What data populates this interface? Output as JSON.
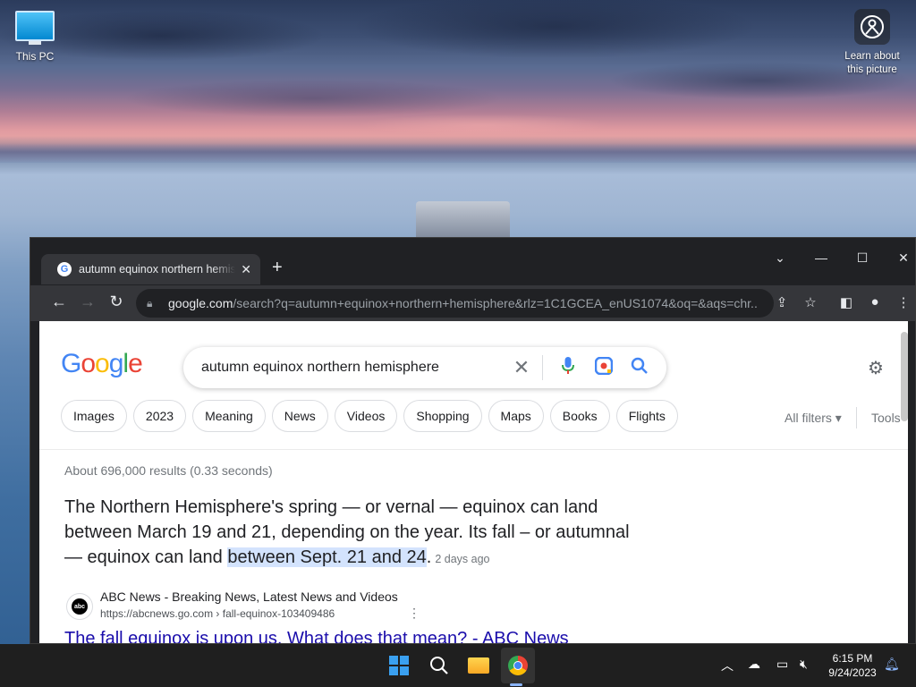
{
  "desktop": {
    "icons": [
      {
        "label": "This PC"
      },
      {
        "label": "Learn about this picture"
      }
    ]
  },
  "browser": {
    "tab_title": "autumn equinox northern hemisphere - Google Search",
    "url_host": "google.com",
    "url_rest": "/search?q=autumn+equinox+northern+hemisphere&rlz=1C1GCEA_enUS1074&oq=&aqs=chr..."
  },
  "google": {
    "logo_letters": [
      "G",
      "o",
      "o",
      "g",
      "l",
      "e"
    ],
    "query": "autumn equinox northern hemisphere",
    "chips": [
      "Images",
      "2023",
      "Meaning",
      "News",
      "Videos",
      "Shopping",
      "Maps",
      "Books",
      "Flights"
    ],
    "all_filters": "All filters",
    "tools": "Tools",
    "stats": "About 696,000 results (0.33 seconds)",
    "snippet": {
      "text": "The Northern Hemisphere's spring — or vernal — equinox can land between March 19 and 21, depending on the year. Its fall – or autumnal — equinox can land ",
      "highlight": "between Sept. 21 and 24",
      "end": ".",
      "date": "2 days ago"
    },
    "result": {
      "favicon_text": "abc",
      "site_name": "ABC News - Breaking News, Latest News and Videos",
      "cite": "https://abcnews.go.com › fall-equinox-103409486",
      "title": "The fall equinox is upon us. What does that mean? - ABC News"
    }
  },
  "taskbar": {
    "time": "6:15 PM",
    "date": "9/24/2023"
  },
  "colors": {
    "google_blue": "#4285f4",
    "google_red": "#ea4335",
    "google_yellow": "#fbbc05",
    "google_green": "#34a853",
    "link": "#1a0dab",
    "highlight": "#d3e3fd"
  }
}
